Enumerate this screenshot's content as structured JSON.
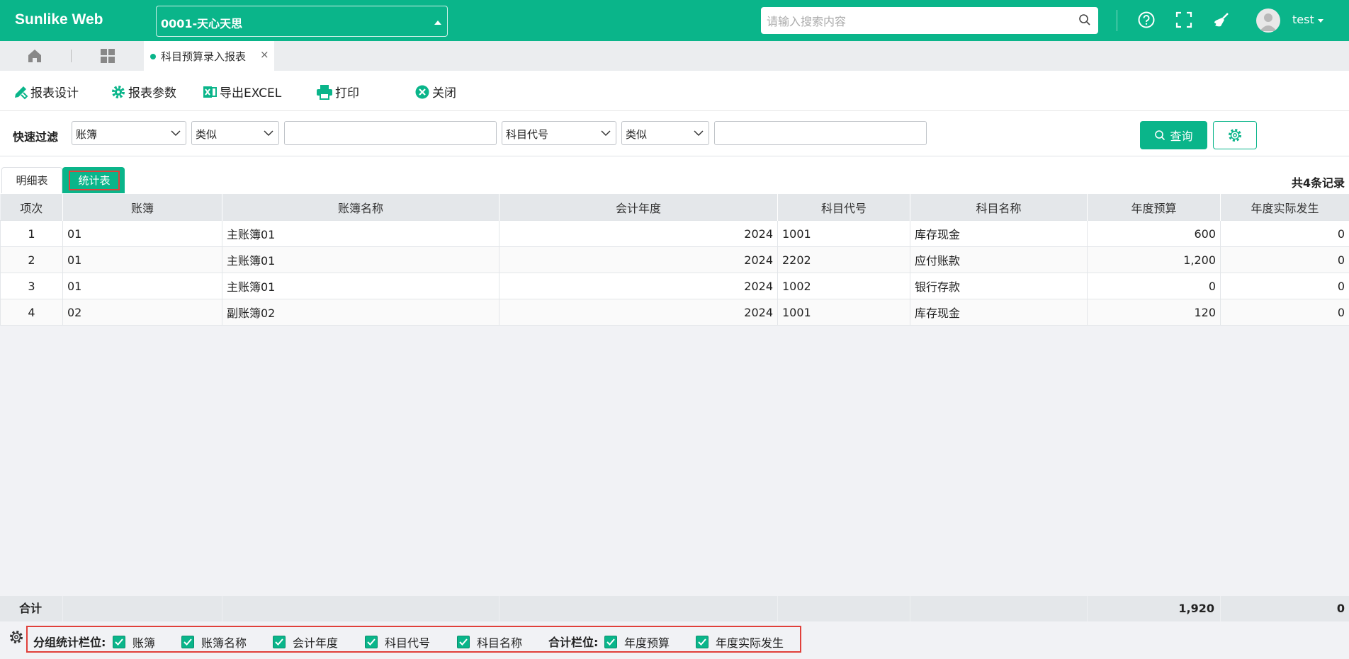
{
  "app": {
    "brand": "Sunlike Web",
    "org_selector": "0001-天心天思",
    "user": "test"
  },
  "search": {
    "placeholder": "请输入搜索内容"
  },
  "tabs": {
    "active_tab": "科目预算录入报表",
    "close": "×"
  },
  "toolbar": {
    "design": "报表设计",
    "params": "报表参数",
    "export": "导出EXCEL",
    "print": "打印",
    "close": "关闭"
  },
  "filter": {
    "label": "快速过滤",
    "field1": "账簿",
    "op1": "类似",
    "value1": "",
    "field2": "科目代号",
    "op2": "类似",
    "value2": "",
    "query": "查询"
  },
  "subtabs": {
    "detail": "明细表",
    "summary": "统计表",
    "record_count": "共4条记录"
  },
  "table": {
    "headers": [
      "项次",
      "账簿",
      "账簿名称",
      "会计年度",
      "科目代号",
      "科目名称",
      "年度预算",
      "年度实际发生"
    ],
    "rows": [
      [
        "1",
        "01",
        "主账簿01",
        "2024",
        "1001",
        "库存现金",
        "600",
        "0"
      ],
      [
        "2",
        "01",
        "主账簿01",
        "2024",
        "2202",
        "应付账款",
        "1,200",
        "0"
      ],
      [
        "3",
        "01",
        "主账簿01",
        "2024",
        "1002",
        "银行存款",
        "0",
        "0"
      ],
      [
        "4",
        "02",
        "副账簿02",
        "2024",
        "1001",
        "库存现金",
        "120",
        "0"
      ]
    ]
  },
  "totals": {
    "label": "合计",
    "budget": "1,920",
    "actual": "0"
  },
  "bottom": {
    "group_label": "分组统计栏位:",
    "group_fields": [
      "账簿",
      "账簿名称",
      "会计年度",
      "科目代号",
      "科目名称"
    ],
    "sum_label": "合计栏位:",
    "sum_fields": [
      "年度预算",
      "年度实际发生"
    ]
  },
  "colors": {
    "accent": "#0ab58a",
    "highlight": "#e0403a"
  }
}
